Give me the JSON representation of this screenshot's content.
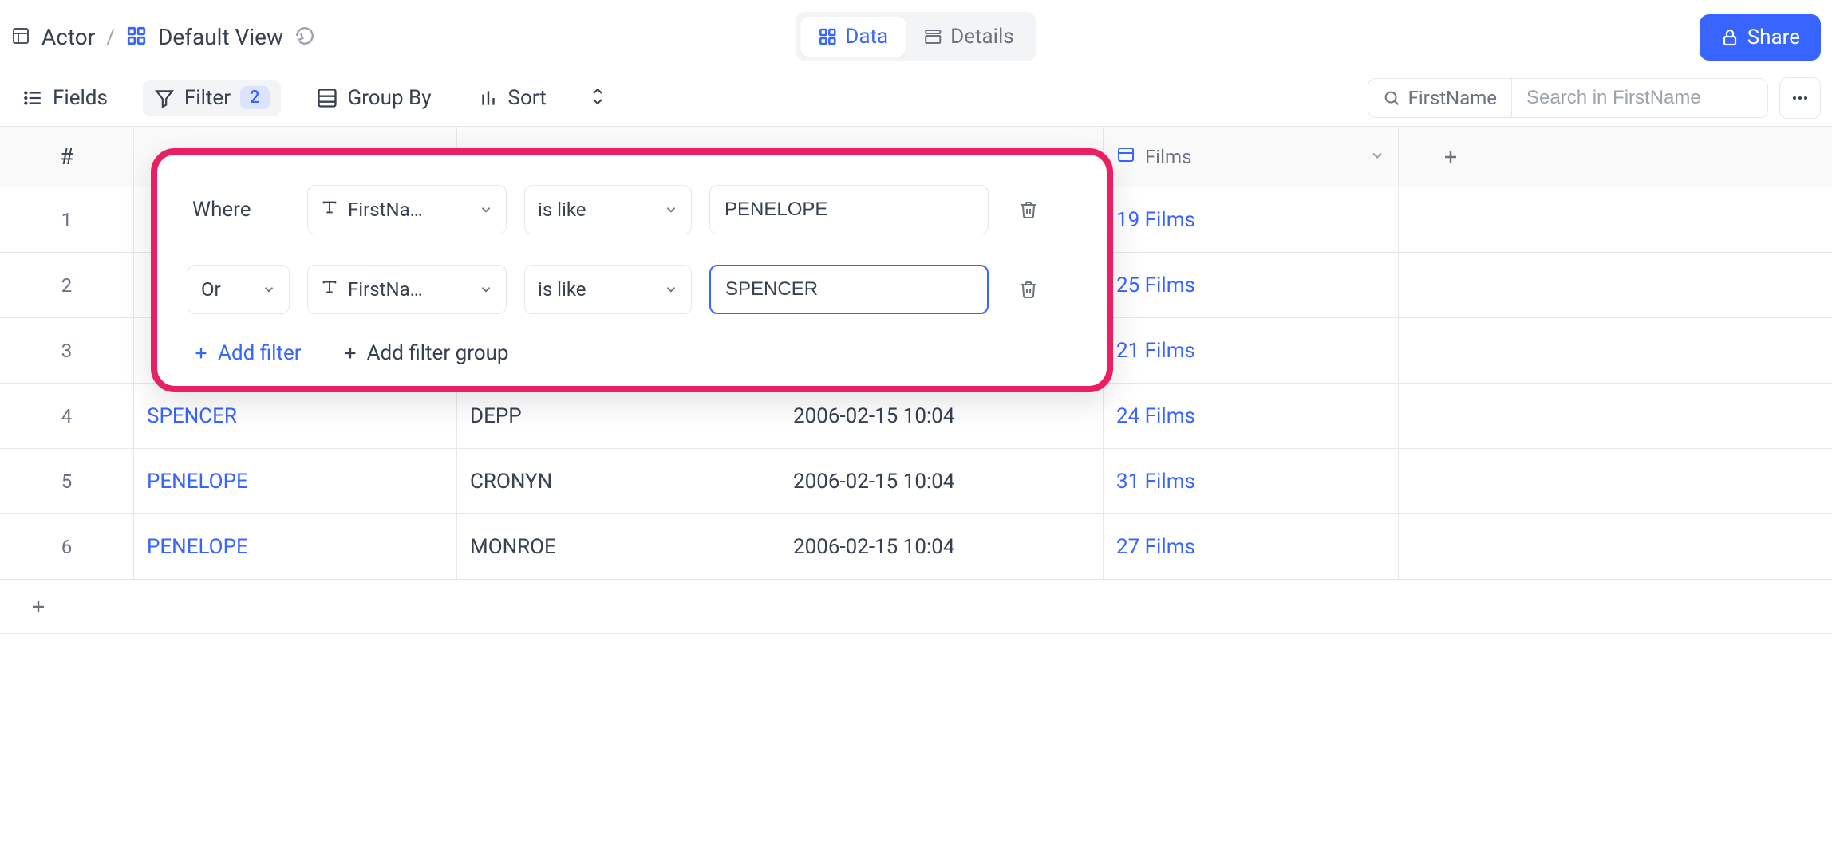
{
  "header": {
    "table_name": "Actor",
    "view_name": "Default View",
    "tabs": {
      "data": "Data",
      "details": "Details"
    },
    "share_label": "Share"
  },
  "toolbar": {
    "fields_label": "Fields",
    "filter_label": "Filter",
    "filter_count": "2",
    "group_label": "Group By",
    "sort_label": "Sort",
    "search_field": "FirstName",
    "search_placeholder": "Search in FirstName"
  },
  "columns": {
    "rownum": "#",
    "films": "Films"
  },
  "rows": [
    {
      "n": "1",
      "first": "",
      "last": "",
      "update": "",
      "films": "19 Films"
    },
    {
      "n": "2",
      "first": "",
      "last": "",
      "update": "",
      "films": "25 Films"
    },
    {
      "n": "3",
      "first": "",
      "last": "",
      "update": "",
      "films": "21 Films"
    },
    {
      "n": "4",
      "first": "SPENCER",
      "last": "DEPP",
      "update": "2006-02-15 10:04",
      "films": "24 Films"
    },
    {
      "n": "5",
      "first": "PENELOPE",
      "last": "CRONYN",
      "update": "2006-02-15 10:04",
      "films": "31 Films"
    },
    {
      "n": "6",
      "first": "PENELOPE",
      "last": "MONROE",
      "update": "2006-02-15 10:04",
      "films": "27 Films"
    }
  ],
  "filter": {
    "where_label": "Where",
    "rows": [
      {
        "logic": "",
        "field": "FirstNa…",
        "op": "is like",
        "value": "PENELOPE",
        "focused": false
      },
      {
        "logic": "Or",
        "field": "FirstNa…",
        "op": "is like",
        "value": "SPENCER",
        "focused": true
      }
    ],
    "add_filter_label": "Add filter",
    "add_group_label": "Add filter group"
  }
}
